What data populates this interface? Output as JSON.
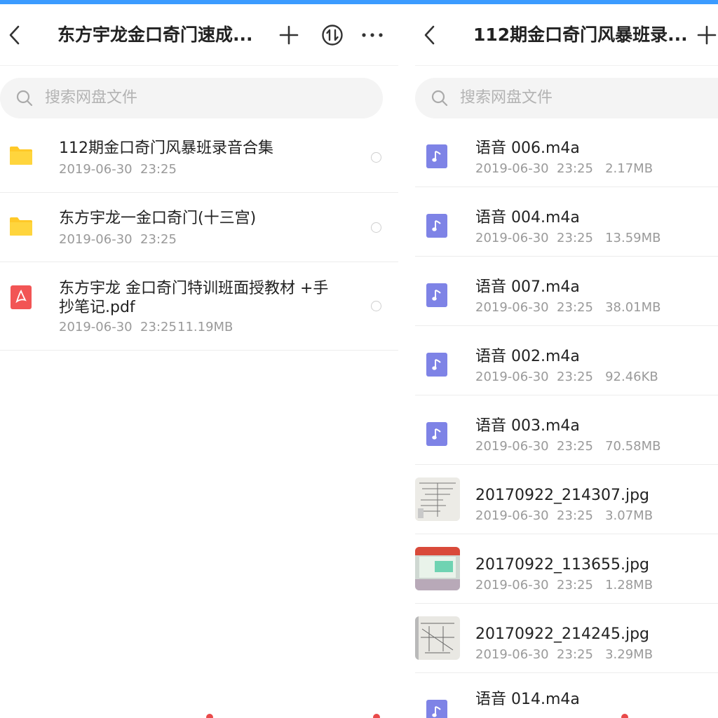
{
  "left": {
    "title": "东方宇龙金口奇门速成...",
    "search_placeholder": "搜索网盘文件",
    "items": [
      {
        "name": "112期金口奇门风暴班录音合集",
        "date": "2019-06-30  23:25",
        "size": "",
        "icon": "folder-icon"
      },
      {
        "name": "东方宇龙一金口奇门(十三宫)",
        "date": "2019-06-30  23:25",
        "size": "",
        "icon": "folder-icon"
      },
      {
        "name": "东方宇龙  金口奇门特训班面授教材 +手抄笔记.pdf",
        "name_line1": "东方宇龙  金口奇门特训班面授教材 +手",
        "name_line2": "抄笔记.pdf",
        "date": "2019-06-30  23:25",
        "size": "11.19MB",
        "icon": "pdf-icon"
      }
    ]
  },
  "right": {
    "title": "112期金口奇门风暴班录...",
    "search_placeholder": "搜索网盘文件",
    "items": [
      {
        "name": "语音 006.m4a",
        "meta": "2019-06-30  23:25   2.17MB",
        "icon": "music-file-icon"
      },
      {
        "name": "语音 004.m4a",
        "meta": "2019-06-30  23:25   13.59MB",
        "icon": "music-file-icon"
      },
      {
        "name": "语音 007.m4a",
        "meta": "2019-06-30  23:25   38.01MB",
        "icon": "music-file-icon"
      },
      {
        "name": "语音 002.m4a",
        "meta": "2019-06-30  23:25   92.46KB",
        "icon": "music-file-icon"
      },
      {
        "name": "语音 003.m4a",
        "meta": "2019-06-30  23:25   70.58MB",
        "icon": "music-file-icon"
      },
      {
        "name": "20170922_214307.jpg",
        "meta": "2019-06-30  23:25   3.07MB",
        "icon": "image-thumbnail"
      },
      {
        "name": "20170922_113655.jpg",
        "meta": "2019-06-30  23:25   1.28MB",
        "icon": "image-thumbnail"
      },
      {
        "name": "20170922_214245.jpg",
        "meta": "2019-06-30  23:25   3.29MB",
        "icon": "image-thumbnail"
      },
      {
        "name": "语音 014.m4a",
        "meta": "",
        "icon": "music-file-icon"
      }
    ]
  },
  "colors": {
    "accent": "#3b9bff",
    "folder": "#ffc928",
    "pdf": "#f25555",
    "music": "#7e83e6"
  }
}
